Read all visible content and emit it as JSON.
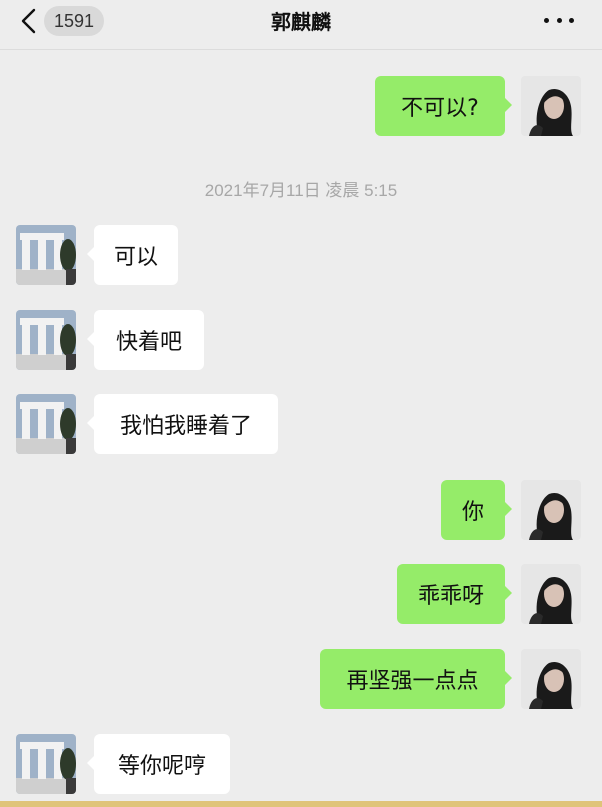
{
  "header": {
    "back_icon": "chevron-left-icon",
    "unread_count": "1591",
    "title": "郭麒麟",
    "more_icon": "more-dots-icon"
  },
  "timestamp": "2021年7月11日 凌晨 5:15",
  "messages": [
    {
      "side": "out",
      "text": "不可以?"
    },
    {
      "side": "in",
      "text": "可以"
    },
    {
      "side": "in",
      "text": "快着吧"
    },
    {
      "side": "in",
      "text": "我怕我睡着了"
    },
    {
      "side": "out",
      "text": "你"
    },
    {
      "side": "out",
      "text": "乖乖呀"
    },
    {
      "side": "out",
      "text": "再坚强一点点"
    },
    {
      "side": "in",
      "text": "等你呢哼"
    }
  ],
  "colors": {
    "background": "#ededed",
    "outgoing_bubble": "#95ec69",
    "incoming_bubble": "#ffffff",
    "timestamp_text": "#a7a7a7"
  }
}
